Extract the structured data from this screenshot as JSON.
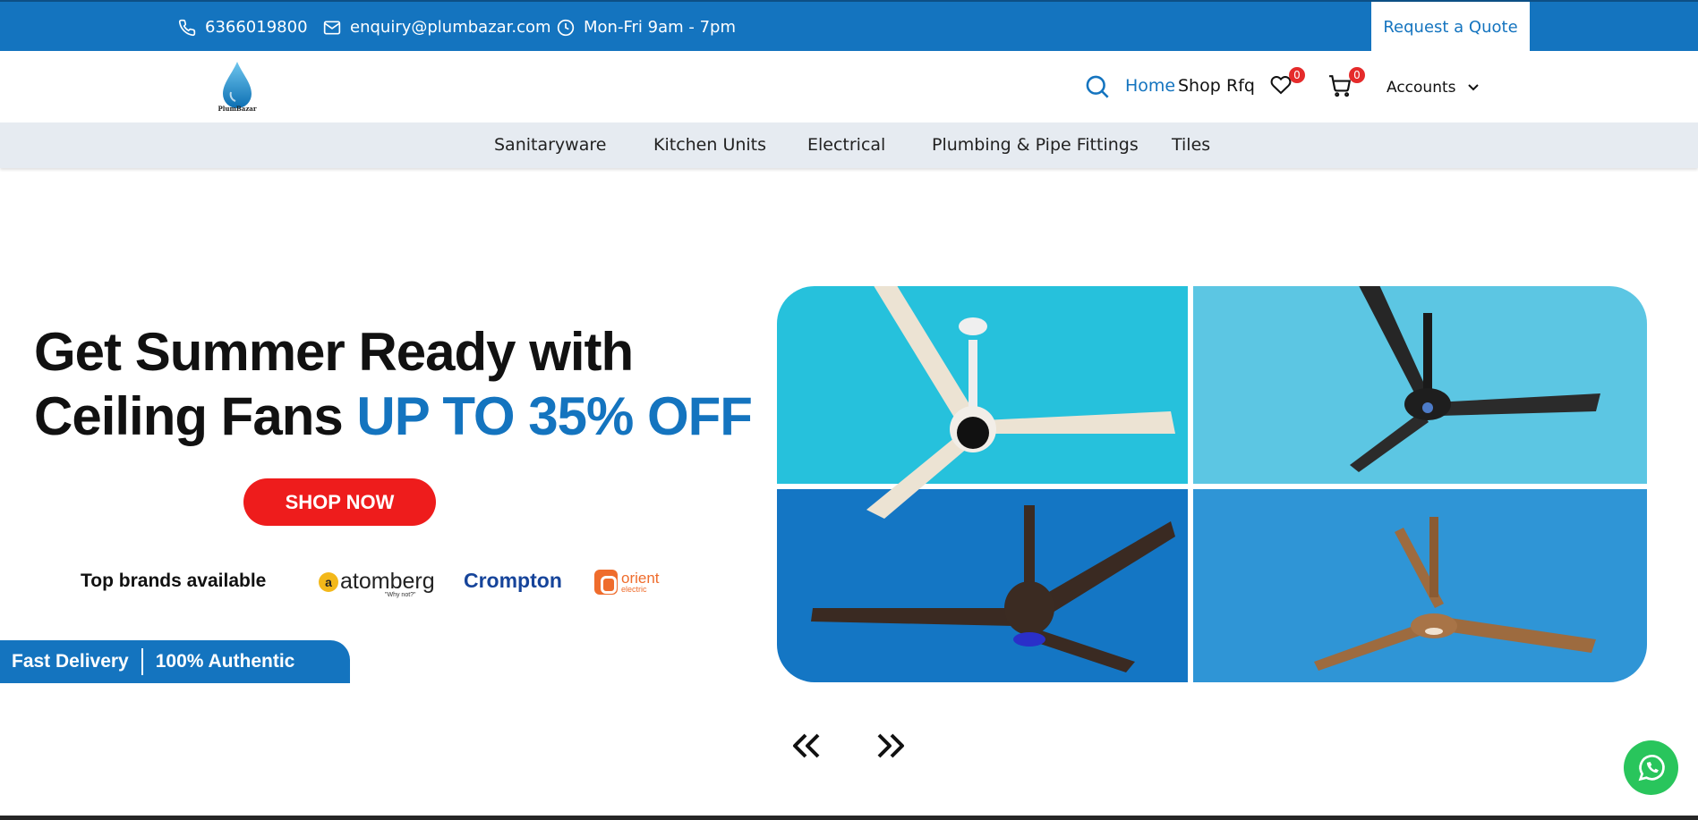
{
  "topbar": {
    "phone": "6366019800",
    "email": "enquiry@plumbazar.com",
    "hours": "Mon-Fri 9am - 7pm",
    "quote_label": "Request a Quote",
    "bg_color": "#1474bf"
  },
  "header": {
    "logo_text": "PlumBazar",
    "nav": {
      "home": "Home",
      "shop": "Shop",
      "rfq": "Rfq"
    },
    "wishlist_count": "0",
    "cart_count": "0",
    "accounts_label": "Accounts"
  },
  "categories": {
    "sanitaryware": "Sanitaryware",
    "kitchen": "Kitchen Units",
    "electrical": "Electrical",
    "plumbing": "Plumbing & Pipe Fittings",
    "tiles": "Tiles"
  },
  "banner": {
    "headline_line1": "Get Summer Ready with",
    "headline_line2": "Ceiling Fans",
    "headline_accent": "UP TO 35% OFF",
    "cta": "SHOP NOW",
    "brands_label": "Top brands available",
    "brand_atomberg": "atomberg",
    "brand_atomberg_tagline": "\"Why not?\"",
    "brand_crompton": "Crompton",
    "brand_orient": "orient",
    "brand_orient_sub": "electric",
    "delivery": "Fast Delivery",
    "authentic": "100% Authentic",
    "accent_color": "#1474bf",
    "cta_color": "#ee1c1c"
  },
  "carousel": {
    "prev": "«",
    "next": "»"
  }
}
